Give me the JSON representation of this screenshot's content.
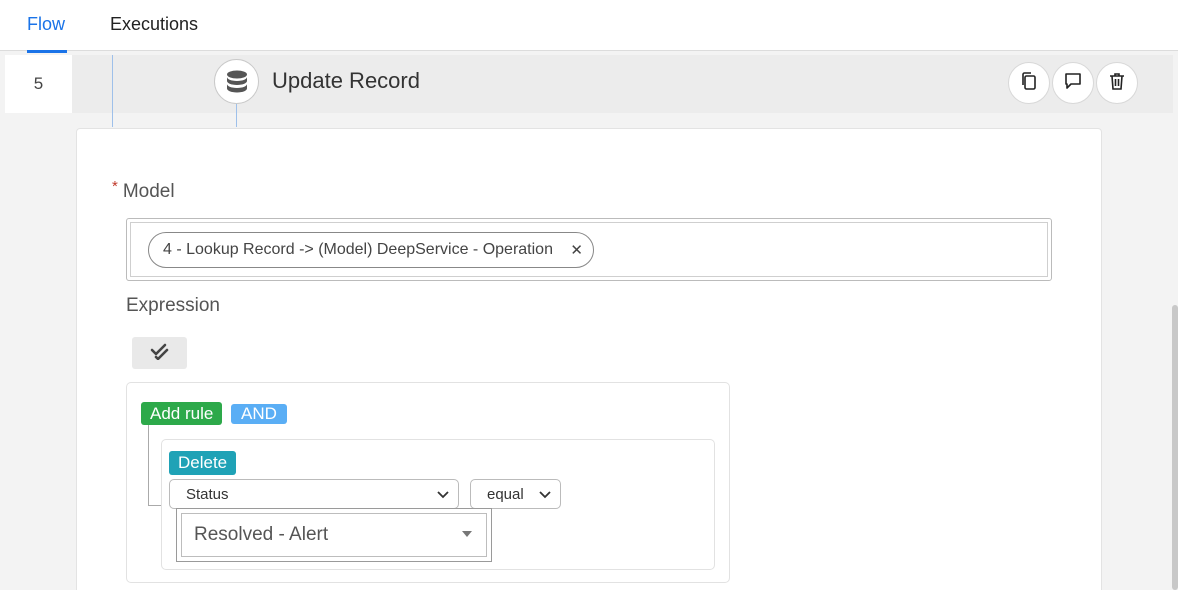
{
  "tabs": {
    "flow": "Flow",
    "executions": "Executions"
  },
  "step": {
    "number": "5",
    "title": "Update Record",
    "icon": "database-icon"
  },
  "actions": {
    "copy_icon": "copy-icon",
    "comment_icon": "comment-icon",
    "delete_icon": "trash-icon"
  },
  "form": {
    "model_required_mark": "*",
    "model_label": "Model",
    "model_value": "4 - Lookup Record -> (Model) DeepService - Operation",
    "model_clear": "✕",
    "expression_label": "Expression"
  },
  "query": {
    "add_rule": "Add rule",
    "and": "AND",
    "delete": "Delete",
    "field": "Status",
    "operator": "equal",
    "value": "Resolved - Alert"
  },
  "colors": {
    "accent": "#1a73e8",
    "add_rule": "#2da94a",
    "and": "#5aaef5",
    "delete": "#1fa2b6"
  }
}
